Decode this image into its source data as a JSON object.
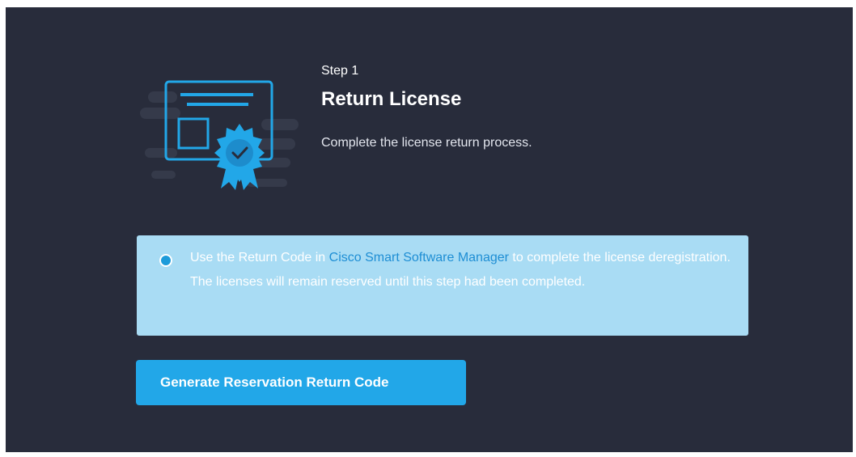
{
  "step": {
    "label": "Step 1",
    "title": "Return License",
    "description": "Complete the license return process."
  },
  "info": {
    "icon": "info-icon",
    "text_before": "Use the Return Code in ",
    "link_text": "Cisco Smart Software Manager",
    "text_after": " to complete the license deregistration. The licenses will remain reserved until this step had been completed."
  },
  "action": {
    "button_label": "Generate Reservation Return Code"
  },
  "illustration": {
    "icon": "license-certificate-icon"
  },
  "colors": {
    "panel_bg": "#282c3b",
    "accent": "#22a7e8",
    "banner_bg": "#a9dcf4",
    "link": "#1e8ed4"
  }
}
